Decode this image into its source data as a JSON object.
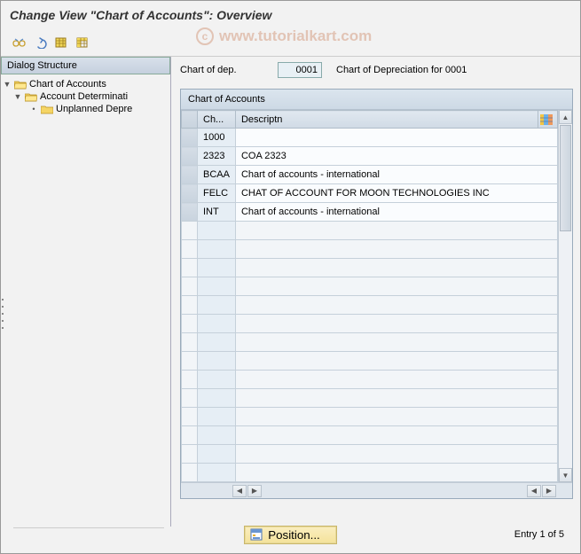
{
  "title": "Change View \"Chart of Accounts\": Overview",
  "watermark": "www.tutorialkart.com",
  "sidebar": {
    "header": "Dialog Structure",
    "items": [
      {
        "label": "Chart of Accounts"
      },
      {
        "label": "Account Determinati"
      },
      {
        "label": "Unplanned Depre"
      }
    ]
  },
  "field": {
    "label": "Chart of dep.",
    "value": "0001",
    "desc": "Chart of Depreciation for 0001"
  },
  "panel": {
    "title": "Chart of Accounts",
    "columns": {
      "ch": "Ch...",
      "desc": "Descriptn"
    },
    "rows": [
      {
        "ch": "1000",
        "desc": ""
      },
      {
        "ch": "2323",
        "desc": "COA 2323"
      },
      {
        "ch": "BCAA",
        "desc": "Chart of accounts - international"
      },
      {
        "ch": "FELC",
        "desc": "CHAT OF ACCOUNT FOR MOON TECHNOLOGIES INC"
      },
      {
        "ch": "INT",
        "desc": "Chart of accounts - international"
      }
    ]
  },
  "footer": {
    "position": "Position...",
    "entry": "Entry 1 of 5"
  }
}
